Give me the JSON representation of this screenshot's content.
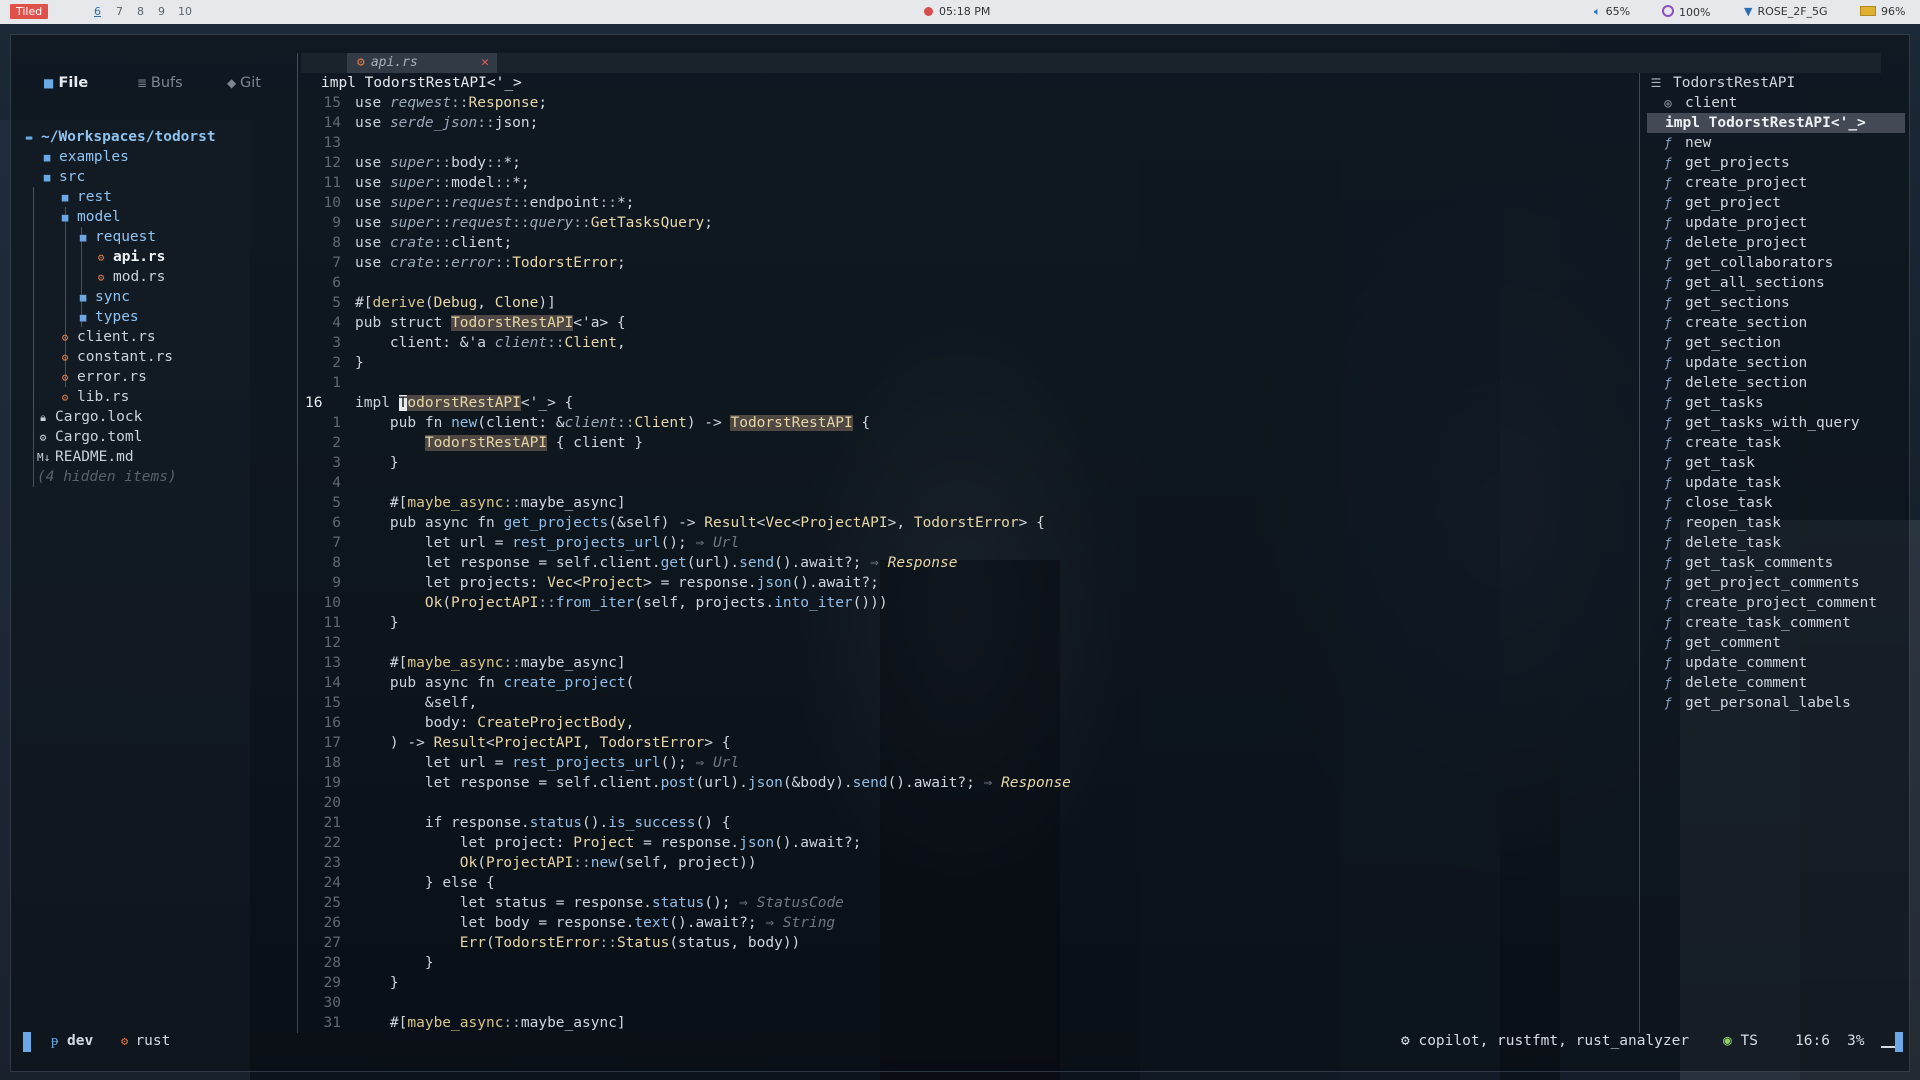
{
  "topbar": {
    "layout_badge": "Tiled",
    "workspaces": [
      "6",
      "7",
      "8",
      "9",
      "10"
    ],
    "active_workspace": "6",
    "clock": "05:18 PM",
    "volume": "65%",
    "brightness": "100%",
    "wifi": "ROSE_2F_5G",
    "battery": "96%"
  },
  "explorer": {
    "tabs": [
      "File",
      "Bufs",
      "Git"
    ],
    "tab_icons": [
      "folder-icon",
      "list-icon",
      "git-icon"
    ],
    "root": "~/Workspaces/todorst",
    "items": [
      {
        "label": "examples",
        "type": "folder"
      },
      {
        "label": "src",
        "type": "folder"
      },
      {
        "label": "rest",
        "type": "folder"
      },
      {
        "label": "model",
        "type": "folder"
      },
      {
        "label": "request",
        "type": "folder"
      },
      {
        "label": "api.rs",
        "type": "rust"
      },
      {
        "label": "mod.rs",
        "type": "rust"
      },
      {
        "label": "sync",
        "type": "folder"
      },
      {
        "label": "types",
        "type": "folder"
      },
      {
        "label": "client.rs",
        "type": "rust"
      },
      {
        "label": "constant.rs",
        "type": "rust"
      },
      {
        "label": "error.rs",
        "type": "rust"
      },
      {
        "label": "lib.rs",
        "type": "rust"
      },
      {
        "label": "Cargo.lock",
        "type": "lock"
      },
      {
        "label": "Cargo.toml",
        "type": "gear"
      },
      {
        "label": "README.md",
        "type": "md"
      },
      {
        "label": "(4 hidden items)",
        "type": "hidden"
      }
    ]
  },
  "tabline": {
    "file": "api.rs"
  },
  "breadcrumb": "impl TodorstRestAPI<'_>",
  "code": {
    "lines": [
      {
        "n": "15",
        "t": "use reqwest::Response;"
      },
      {
        "n": "14",
        "t": "use serde_json::json;"
      },
      {
        "n": "13",
        "t": ""
      },
      {
        "n": "12",
        "t": "use super::body::*;"
      },
      {
        "n": "11",
        "t": "use super::model::*;"
      },
      {
        "n": "10",
        "t": "use super::request::endpoint::*;"
      },
      {
        "n": "9",
        "t": "use super::request::query::GetTasksQuery;"
      },
      {
        "n": "8",
        "t": "use crate::client;"
      },
      {
        "n": "7",
        "t": "use crate::error::TodorstError;"
      },
      {
        "n": "6",
        "t": ""
      },
      {
        "n": "5",
        "t": "#[derive(Debug, Clone)]"
      },
      {
        "n": "4",
        "t": "pub struct TodorstRestAPI<'a> {"
      },
      {
        "n": "3",
        "t": "    client: &'a client::Client,"
      },
      {
        "n": "2",
        "t": "}"
      },
      {
        "n": "1",
        "t": ""
      },
      {
        "n": "16",
        "t": "impl TodorstRestAPI<'_> {"
      },
      {
        "n": "1",
        "t": "    pub fn new(client: &client::Client) -> TodorstRestAPI {"
      },
      {
        "n": "2",
        "t": "        TodorstRestAPI { client }"
      },
      {
        "n": "3",
        "t": "    }"
      },
      {
        "n": "4",
        "t": ""
      },
      {
        "n": "5",
        "t": "    #[maybe_async::maybe_async]"
      },
      {
        "n": "6",
        "t": "    pub async fn get_projects(&self) -> Result<Vec<ProjectAPI>, TodorstError> {"
      },
      {
        "n": "7",
        "t": "        let url = rest_projects_url(); ⇒ Url"
      },
      {
        "n": "8",
        "t": "        let response = self.client.get(url).send().await?; ⇒ Response"
      },
      {
        "n": "9",
        "t": "        let projects: Vec<Project> = response.json().await?;"
      },
      {
        "n": "10",
        "t": "        Ok(ProjectAPI::from_iter(self, projects.into_iter()))"
      },
      {
        "n": "11",
        "t": "    }"
      },
      {
        "n": "12",
        "t": ""
      },
      {
        "n": "13",
        "t": "    #[maybe_async::maybe_async]"
      },
      {
        "n": "14",
        "t": "    pub async fn create_project("
      },
      {
        "n": "15",
        "t": "        &self,"
      },
      {
        "n": "16",
        "t": "        body: CreateProjectBody,"
      },
      {
        "n": "17",
        "t": "    ) -> Result<ProjectAPI, TodorstError> {"
      },
      {
        "n": "18",
        "t": "        let url = rest_projects_url(); ⇒ Url"
      },
      {
        "n": "19",
        "t": "        let response = self.client.post(url).json(&body).send().await?; ⇒ Response"
      },
      {
        "n": "20",
        "t": ""
      },
      {
        "n": "21",
        "t": "        if response.status().is_success() {"
      },
      {
        "n": "22",
        "t": "            let project: Project = response.json().await?;"
      },
      {
        "n": "23",
        "t": "            Ok(ProjectAPI::new(self, project))"
      },
      {
        "n": "24",
        "t": "        } else {"
      },
      {
        "n": "25",
        "t": "            let status = response.status(); ⇒ StatusCode"
      },
      {
        "n": "26",
        "t": "            let body = response.text().await?; ⇒ String"
      },
      {
        "n": "27",
        "t": "            Err(TodorstError::Status(status, body))"
      },
      {
        "n": "28",
        "t": "        }"
      },
      {
        "n": "29",
        "t": "    }"
      },
      {
        "n": "30",
        "t": ""
      },
      {
        "n": "31",
        "t": "    #[maybe_async::maybe_async]"
      }
    ]
  },
  "outline": {
    "title": "TodorstRestAPI",
    "field": "client",
    "impl": "impl TodorstRestAPI<'_>",
    "fns": [
      "new",
      "get_projects",
      "create_project",
      "get_project",
      "update_project",
      "delete_project",
      "get_collaborators",
      "get_all_sections",
      "get_sections",
      "create_section",
      "get_section",
      "update_section",
      "delete_section",
      "get_tasks",
      "get_tasks_with_query",
      "create_task",
      "get_task",
      "update_task",
      "close_task",
      "reopen_task",
      "delete_task",
      "get_task_comments",
      "get_project_comments",
      "create_project_comment",
      "create_task_comment",
      "get_comment",
      "update_comment",
      "delete_comment",
      "get_personal_labels"
    ]
  },
  "status": {
    "branch": "dev",
    "filetype": "rust",
    "lsp": "copilot, rustfmt, rust_analyzer",
    "ts": "TS",
    "position": "16:6",
    "percent": "3%"
  },
  "colors": {
    "accent": "#6aa9e6",
    "badge": "#e0514a",
    "rust": "#d97a4a"
  }
}
